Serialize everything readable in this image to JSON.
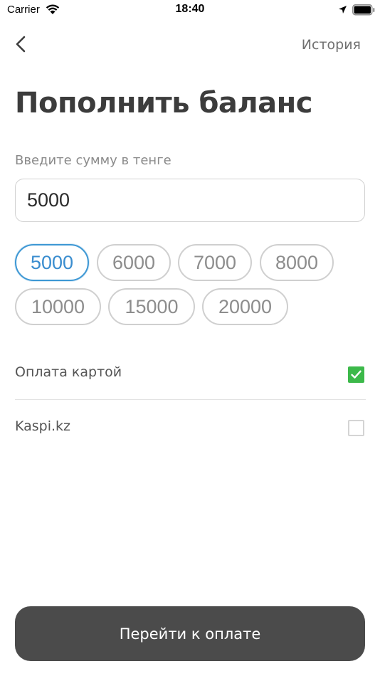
{
  "status": {
    "carrier": "Carrier",
    "time": "18:40"
  },
  "nav": {
    "history_label": "История"
  },
  "page": {
    "title": "Пополнить баланс",
    "amount_label": "Введите сумму в тенге",
    "amount_value": "5000"
  },
  "chips": [
    "5000",
    "6000",
    "7000",
    "8000",
    "10000",
    "15000",
    "20000"
  ],
  "selected_chip": "5000",
  "methods": [
    {
      "label": "Оплата картой",
      "checked": true
    },
    {
      "label": "Kaspi.kz",
      "checked": false
    }
  ],
  "pay_button_label": "Перейти к оплате",
  "colors": {
    "accent": "#3c97d4",
    "check": "#3cb94a",
    "button": "#4b4b4b"
  }
}
